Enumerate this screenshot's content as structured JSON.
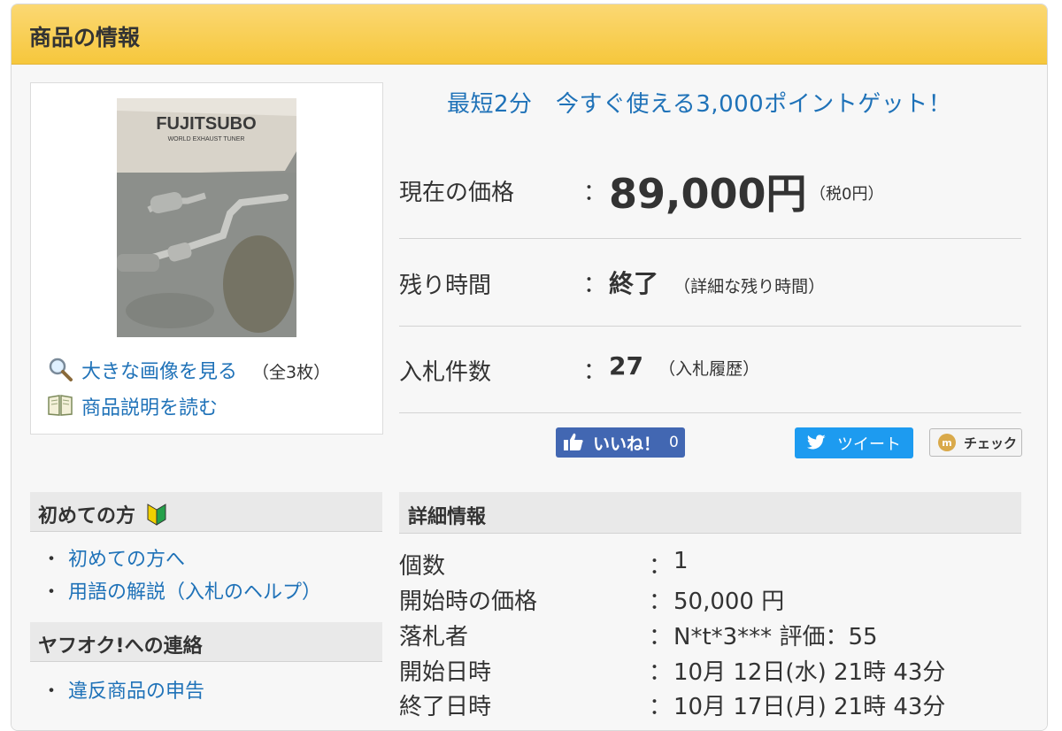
{
  "panel": {
    "title": "商品の情報"
  },
  "image_box": {
    "photo_alt": "FUJITSUBO",
    "photo_sub": "WORLD EXHAUST TUNER",
    "large_image_link": "大きな画像を見る",
    "image_count": "（全3枚）",
    "description_link": "商品説明を読む"
  },
  "promo": "最短2分　今すぐ使える3,000ポイントゲット！",
  "price": {
    "label": "現在の価格",
    "colon": "：",
    "value": "89,000円",
    "tax": "（税0円）"
  },
  "remaining": {
    "label": "残り時間",
    "colon": "：",
    "value": "終了",
    "open_paren": "（",
    "link": "詳細な残り時間",
    "close_paren": "）"
  },
  "bids": {
    "label": "入札件数",
    "colon": "：",
    "value": "27",
    "open_paren": "（",
    "link": "入札履歴",
    "close_paren": "）"
  },
  "social": {
    "like_label": "いいね！",
    "like_count": "0",
    "tweet_label": "ツイート",
    "check_label": "チェック"
  },
  "beginner": {
    "title": "初めての方",
    "items": [
      "初めての方へ",
      "用語の解説（入札のヘルプ）"
    ]
  },
  "contact": {
    "title": "ヤフオク!への連絡",
    "items": [
      "違反商品の申告"
    ]
  },
  "details": {
    "title": "詳細情報",
    "rows": [
      {
        "label": "個数",
        "value": "1"
      },
      {
        "label": "開始時の価格",
        "value": "50,000 円"
      },
      {
        "label": "落札者",
        "value": "N*t*3*** 評価：55"
      },
      {
        "label": "開始日時",
        "value": "10月 12日(水) 21時 43分"
      },
      {
        "label": "終了日時",
        "value": "10月 17日(月) 21時 43分"
      }
    ],
    "colon": "："
  },
  "colors": {
    "header_yellow": "#f6c73c",
    "link_blue": "#1f72b8",
    "facebook_blue": "#4267b2",
    "twitter_blue": "#1d9bf0"
  }
}
